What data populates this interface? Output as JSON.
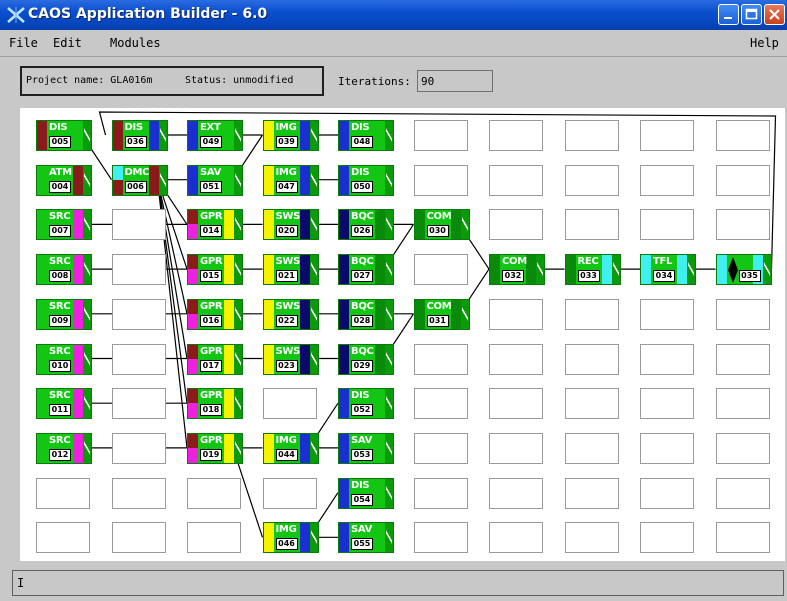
{
  "window": {
    "title": "CAOS Application Builder - 6.0"
  },
  "menu": {
    "file": "File",
    "edit": "Edit",
    "modules": "Modules",
    "help": "Help"
  },
  "project": {
    "name_text": "Project name: GLA016m",
    "status_text": "Status: unmodified"
  },
  "iterations": {
    "label": "Iterations:",
    "value": "90"
  },
  "statusbar": {
    "text": "I"
  },
  "colors": {
    "module_green": "#13c613",
    "cell_border": "#9a9a9a",
    "dark_red": "#8b1a1a",
    "blue": "#1a2fd0",
    "yellow": "#f4f400",
    "magenta": "#f020e0",
    "navy": "#0a0a6a",
    "cyan": "#40f0f0",
    "dark_green": "#0a8a0a",
    "wire": "#000000"
  },
  "modules": [
    {
      "name": "DIS",
      "num": "005",
      "col": 0,
      "row": 0,
      "l": "dark_red",
      "r": "module_green"
    },
    {
      "name": "DIS",
      "num": "036",
      "col": 1,
      "row": 0,
      "l": "dark_red",
      "r": "blue"
    },
    {
      "name": "EXT",
      "num": "049",
      "col": 2,
      "row": 0,
      "l": "blue",
      "r": "module_green"
    },
    {
      "name": "IMG",
      "num": "039",
      "col": 3,
      "row": 0,
      "l": "yellow",
      "r": "blue"
    },
    {
      "name": "DIS",
      "num": "048",
      "col": 4,
      "row": 0,
      "l": "blue",
      "r": "module_green"
    },
    {
      "name": "ATM",
      "num": "004",
      "col": 0,
      "row": 1,
      "l": "module_green",
      "r": "dark_red"
    },
    {
      "name": "DMC",
      "num": "006",
      "col": 1,
      "row": 1,
      "l": "cyan",
      "r": "dark_red",
      "lsplit": "dark_red"
    },
    {
      "name": "SAV",
      "num": "051",
      "col": 2,
      "row": 1,
      "l": "blue",
      "r": "module_green"
    },
    {
      "name": "IMG",
      "num": "047",
      "col": 3,
      "row": 1,
      "l": "yellow",
      "r": "blue"
    },
    {
      "name": "DIS",
      "num": "050",
      "col": 4,
      "row": 1,
      "l": "blue",
      "r": "module_green"
    },
    {
      "name": "SRC",
      "num": "007",
      "col": 0,
      "row": 2,
      "l": "module_green",
      "r": "magenta"
    },
    {
      "name": "GPR",
      "num": "014",
      "col": 2,
      "row": 2,
      "l": "dark_red",
      "r": "yellow",
      "lsplit": "magenta"
    },
    {
      "name": "SWS",
      "num": "020",
      "col": 3,
      "row": 2,
      "l": "yellow",
      "r": "navy"
    },
    {
      "name": "BQC",
      "num": "026",
      "col": 4,
      "row": 2,
      "l": "navy",
      "r": "dark_green"
    },
    {
      "name": "COM",
      "num": "030",
      "col": 5,
      "row": 2,
      "l": "dark_green",
      "r": "dark_green"
    },
    {
      "name": "SRC",
      "num": "008",
      "col": 0,
      "row": 3,
      "l": "module_green",
      "r": "magenta"
    },
    {
      "name": "GPR",
      "num": "015",
      "col": 2,
      "row": 3,
      "l": "dark_red",
      "r": "yellow",
      "lsplit": "magenta"
    },
    {
      "name": "SWS",
      "num": "021",
      "col": 3,
      "row": 3,
      "l": "yellow",
      "r": "navy"
    },
    {
      "name": "BQC",
      "num": "027",
      "col": 4,
      "row": 3,
      "l": "navy",
      "r": "dark_green"
    },
    {
      "name": "COM",
      "num": "032",
      "col": 6,
      "row": 3,
      "l": "dark_green",
      "r": "dark_green"
    },
    {
      "name": "REC",
      "num": "033",
      "col": 7,
      "row": 3,
      "l": "dark_green",
      "r": "cyan"
    },
    {
      "name": "TFL",
      "num": "034",
      "col": 8,
      "row": 3,
      "l": "cyan",
      "r": "cyan"
    },
    {
      "name": "",
      "num": "035",
      "col": 9,
      "row": 3,
      "l": "cyan",
      "r": "cyan",
      "diamond": true
    },
    {
      "name": "SRC",
      "num": "009",
      "col": 0,
      "row": 4,
      "l": "module_green",
      "r": "magenta"
    },
    {
      "name": "GPR",
      "num": "016",
      "col": 2,
      "row": 4,
      "l": "dark_red",
      "r": "yellow",
      "lsplit": "magenta"
    },
    {
      "name": "SWS",
      "num": "022",
      "col": 3,
      "row": 4,
      "l": "yellow",
      "r": "navy"
    },
    {
      "name": "BQC",
      "num": "028",
      "col": 4,
      "row": 4,
      "l": "navy",
      "r": "dark_green"
    },
    {
      "name": "COM",
      "num": "031",
      "col": 5,
      "row": 4,
      "l": "dark_green",
      "r": "dark_green"
    },
    {
      "name": "SRC",
      "num": "010",
      "col": 0,
      "row": 5,
      "l": "module_green",
      "r": "magenta"
    },
    {
      "name": "GPR",
      "num": "017",
      "col": 2,
      "row": 5,
      "l": "dark_red",
      "r": "yellow",
      "lsplit": "magenta"
    },
    {
      "name": "SWS",
      "num": "023",
      "col": 3,
      "row": 5,
      "l": "yellow",
      "r": "navy"
    },
    {
      "name": "BQC",
      "num": "029",
      "col": 4,
      "row": 5,
      "l": "navy",
      "r": "dark_green"
    },
    {
      "name": "SRC",
      "num": "011",
      "col": 0,
      "row": 6,
      "l": "module_green",
      "r": "magenta"
    },
    {
      "name": "GPR",
      "num": "018",
      "col": 2,
      "row": 6,
      "l": "dark_red",
      "r": "yellow",
      "lsplit": "magenta"
    },
    {
      "name": "DIS",
      "num": "052",
      "col": 4,
      "row": 6,
      "l": "blue",
      "r": "module_green"
    },
    {
      "name": "SRC",
      "num": "012",
      "col": 0,
      "row": 7,
      "l": "module_green",
      "r": "magenta"
    },
    {
      "name": "GPR",
      "num": "019",
      "col": 2,
      "row": 7,
      "l": "dark_red",
      "r": "yellow",
      "lsplit": "magenta"
    },
    {
      "name": "IMG",
      "num": "044",
      "col": 3,
      "row": 7,
      "l": "yellow",
      "r": "blue"
    },
    {
      "name": "SAV",
      "num": "053",
      "col": 4,
      "row": 7,
      "l": "blue",
      "r": "module_green"
    },
    {
      "name": "DIS",
      "num": "054",
      "col": 4,
      "row": 8,
      "l": "blue",
      "r": "module_green"
    },
    {
      "name": "IMG",
      "num": "046",
      "col": 3,
      "row": 9,
      "l": "yellow",
      "r": "blue"
    },
    {
      "name": "SAV",
      "num": "055",
      "col": 4,
      "row": 9,
      "l": "blue",
      "r": "module_green"
    }
  ]
}
